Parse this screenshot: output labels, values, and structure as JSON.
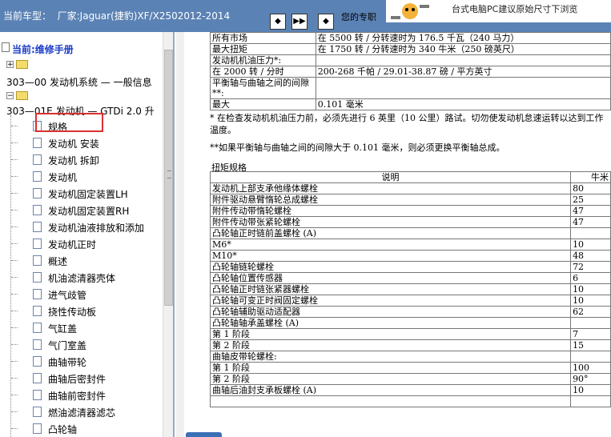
{
  "header": {
    "vehicle_text": "当前车型：  厂家:Jaguar(捷豹)XF/X2502012-2014",
    "nav_buttons": [
      "◆",
      "▶▶",
      "◆"
    ],
    "help_text": "您的专职"
  },
  "ad": {
    "text": "台式电脑PC建议原始尺寸下浏览"
  },
  "tree": {
    "current_label": "当前:维修手册",
    "node1": "303—00 发动机系统 — 一般信息",
    "node2": "303—01E 发动机 — GTDi 2.0 升",
    "items": [
      "规格",
      "发动机 安装",
      "发动机 拆卸",
      "发动机",
      "发动机固定装置LH",
      "发动机固定装置RH",
      "发动机油液排放和添加",
      "发动机正时",
      "概述",
      "机油滤清器壳体",
      "进气歧管",
      "挠性传动板",
      "气缸盖",
      "气门室盖",
      "曲轴带轮",
      "曲轴后密封件",
      "曲轴前密封件",
      "燃油滤清器滤芯",
      "凸轮轴"
    ],
    "selected_index": 0
  },
  "spec_rows": [
    [
      "所有市场",
      "在 5500 转 / 分转速时为 176.5 千瓦（240 马力）"
    ],
    [
      "最大扭矩",
      "在 1750 转 / 分转速时为 340 牛米（250 磅英尺）"
    ],
    [
      "发动机机油压力*:",
      ""
    ],
    [
      "在 2000 转 / 分时",
      "200-268 千帕 / 29.01-38.87 磅 / 平方英寸"
    ],
    [
      "平衡轴与曲轴之间的间隙**:",
      ""
    ],
    [
      "最大",
      "0.101 毫米"
    ]
  ],
  "note1": "* 在检查发动机机油压力前，必须先进行 6 英里（10 公里）路试。切勿使发动机怠速运转以达到工作温度。",
  "note2": "**如果平衡轴与曲轴之间的间隙大于 0.101 毫米，则必须更换平衡轴总成。",
  "torque": {
    "title": "扭矩规格",
    "header_desc": "说明",
    "header_nm": "牛米",
    "rows": [
      [
        "发动机上部支承他缘体螺栓",
        "80"
      ],
      [
        "附件驱动悬臂惰轮总成螺栓",
        "25"
      ],
      [
        "附件传动带惰轮螺栓",
        "47"
      ],
      [
        "附件传动带张紧轮螺栓",
        "47"
      ],
      [
        "凸轮轴正时链前盖螺栓 (A)",
        ""
      ],
      [
        "M6*",
        "10"
      ],
      [
        "M10*",
        "48"
      ],
      [
        "凸轮轴链轮螺栓",
        "72"
      ],
      [
        "凸轮轴位置传感器",
        "6"
      ],
      [
        "凸轮轴正时链张紧器螺栓",
        "10"
      ],
      [
        "凸轮轴可变正时阀固定螺栓",
        "10"
      ],
      [
        "凸轮轴辅助驱动适配器",
        "62"
      ],
      [
        "凸轮轴轴承盖螺栓 (A)",
        ""
      ],
      [
        "第 1 阶段",
        "7"
      ],
      [
        "第 2 阶段",
        "15"
      ],
      [
        "曲轴皮带轮螺栓:",
        ""
      ],
      [
        "第 1 阶段",
        "100"
      ],
      [
        "第 2 阶段",
        "90°"
      ],
      [
        "曲轴后油封支承板螺栓 (A)",
        "10"
      ],
      [
        "",
        ""
      ]
    ]
  },
  "colors": {
    "topbar": "#5b82b4",
    "current_label": "#1a3cc8",
    "selection_box": "#d93030"
  }
}
